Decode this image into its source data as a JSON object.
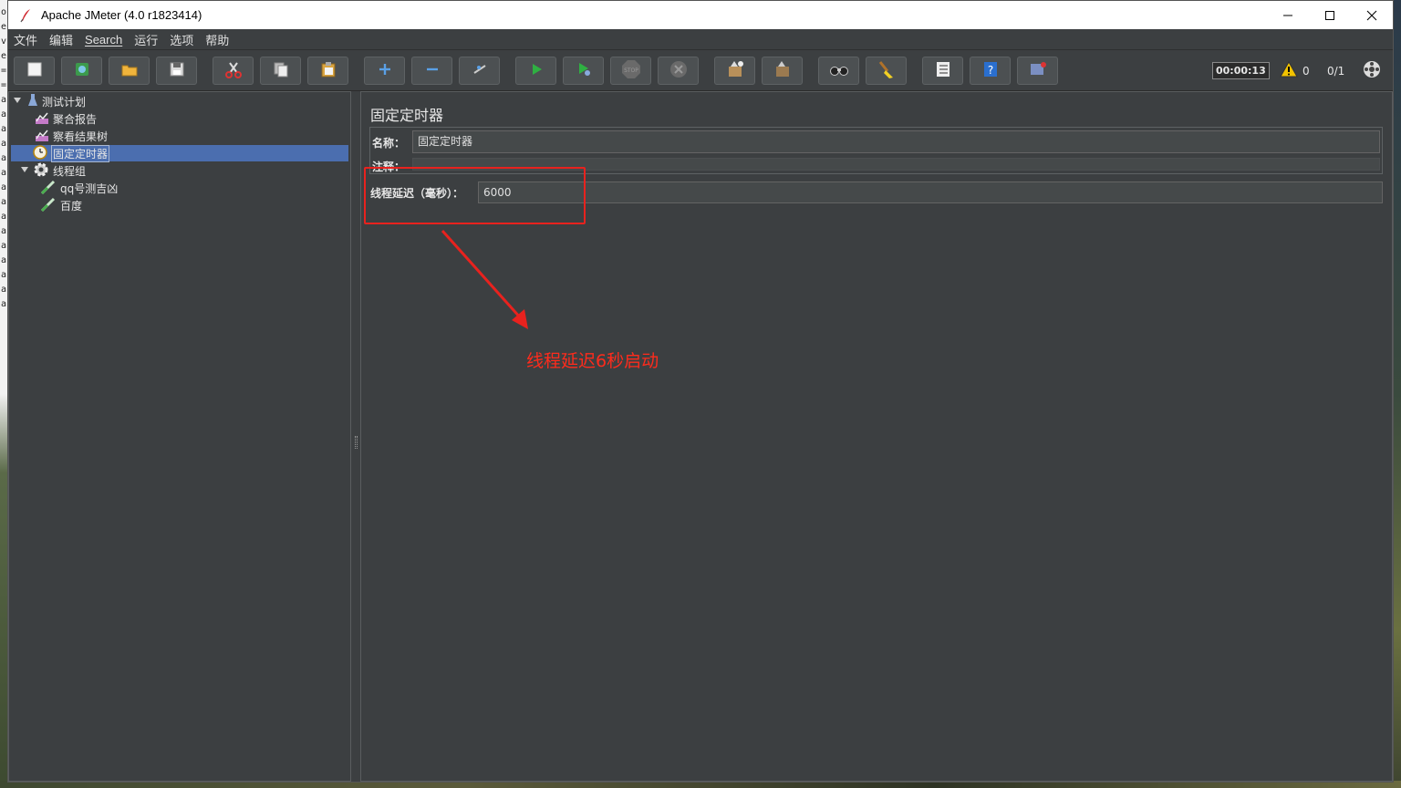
{
  "window": {
    "title": "Apache JMeter (4.0 r1823414)"
  },
  "menu": [
    "文件",
    "编辑",
    "Search",
    "运行",
    "选项",
    "帮助"
  ],
  "toolbar": {
    "buttons": [
      "new-icon",
      "templates-icon",
      "open-icon",
      "save-icon",
      "cut-icon",
      "copy-icon",
      "paste-icon",
      "expand-icon",
      "collapse-icon",
      "toggle-icon",
      "start-icon",
      "start-no-pause-icon",
      "stop-icon",
      "shutdown-icon",
      "remote-start-icon",
      "remote-stop-icon",
      "search-icon",
      "clear-all-icon",
      "function-helper-icon",
      "help-icon",
      "remote-exit-icon"
    ],
    "timer": "00:00:13",
    "warning_count": "0",
    "thread_count": "0/1"
  },
  "tree": {
    "items": [
      {
        "label": "测试计划",
        "icon": "test-plan-icon"
      },
      {
        "label": "聚合报告",
        "icon": "listener-icon"
      },
      {
        "label": "察看结果树",
        "icon": "listener-icon"
      },
      {
        "label": "固定定时器",
        "icon": "timer-icon",
        "selected": true
      },
      {
        "label": "线程组",
        "icon": "thread-group-icon"
      },
      {
        "label": "qq号测吉凶",
        "icon": "sampler-icon"
      },
      {
        "label": "百度",
        "icon": "sampler-icon"
      }
    ]
  },
  "panel": {
    "title": "固定定时器",
    "name_label": "名称：",
    "name_value": "固定定时器",
    "comment_label": "注释：",
    "delay_label": "线程延迟（毫秒）：",
    "delay_value": "6000"
  },
  "annotation": {
    "text": "线程延迟6秒启动",
    "color": "#ff2b1c"
  },
  "background_chars": [
    "o",
    "e",
    "v",
    "e",
    "=",
    "=",
    "a",
    "a",
    "a",
    "a",
    "a",
    "a",
    "a",
    "a",
    "a",
    "a",
    "a",
    "a",
    "a",
    "a",
    "a"
  ]
}
